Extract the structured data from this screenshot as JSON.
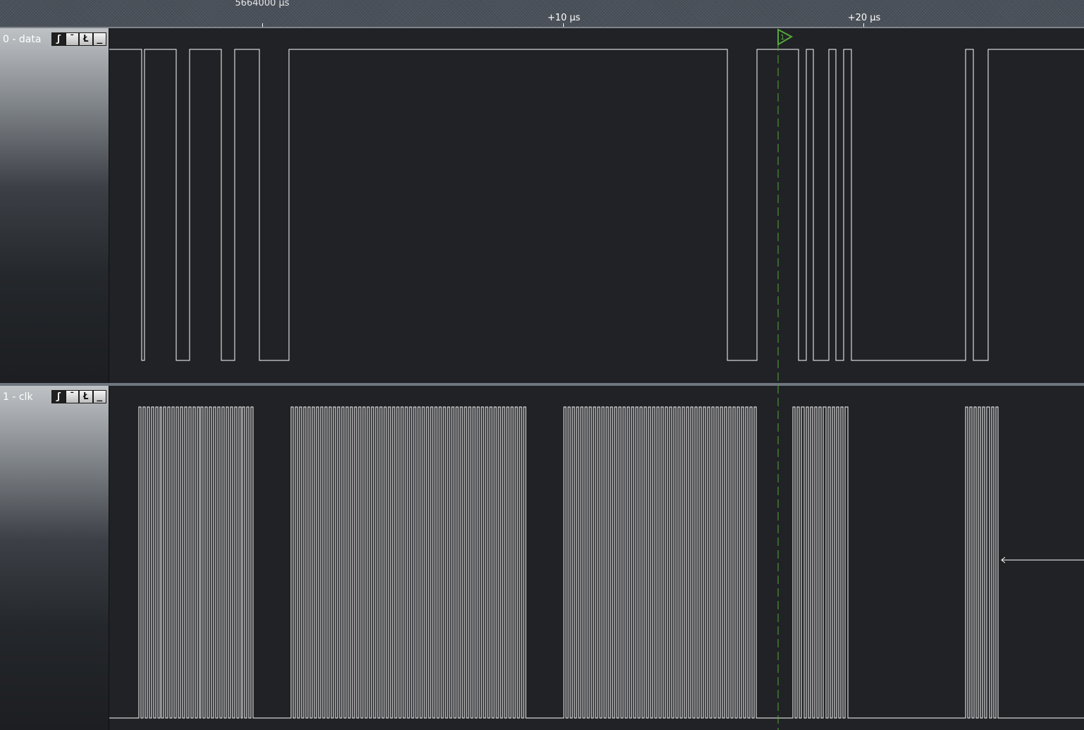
{
  "ruler": {
    "absolute_label": "5664000 µs",
    "marks": [
      "+10 µs",
      "+20 µs"
    ]
  },
  "channels": [
    {
      "name": "0 - data",
      "trigger_buttons": [
        "ʃ",
        "¯",
        "Ł",
        "_"
      ],
      "active_trigger": 0,
      "level_color": "#ffffff"
    },
    {
      "name": "1 - clk",
      "trigger_buttons": [
        "ʃ",
        "¯",
        "Ł",
        "_"
      ],
      "active_trigger": 0,
      "level_color": "#ffffff"
    }
  ],
  "cursor": {
    "label": "1",
    "color": "#55a83a"
  },
  "colors": {
    "background": "#202225",
    "trace": "#ffffff",
    "cursor": "#55a83a"
  }
}
